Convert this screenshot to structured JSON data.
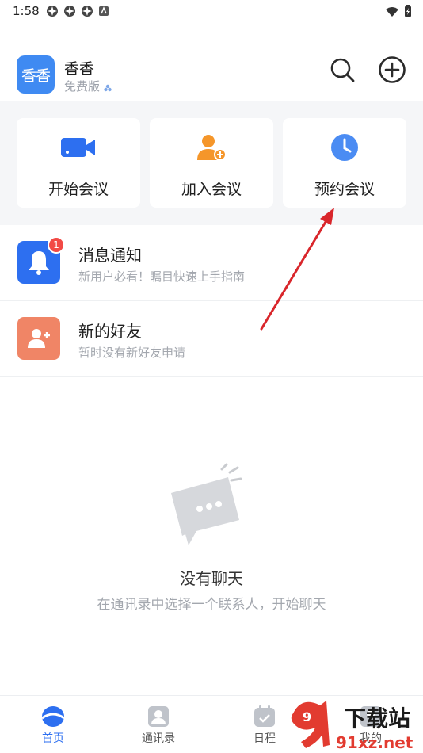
{
  "status_bar": {
    "time": "1:58"
  },
  "header": {
    "avatar_text": "香香",
    "user_name": "香香",
    "plan": "免费版"
  },
  "meeting_actions": [
    {
      "label": "开始会议",
      "icon": "video-camera-icon",
      "color": "#2d6ff0"
    },
    {
      "label": "加入会议",
      "icon": "add-user-icon",
      "color": "#f5962a"
    },
    {
      "label": "预约会议",
      "icon": "clock-icon",
      "color": "#4b8cf3"
    }
  ],
  "list": {
    "notice": {
      "title": "消息通知",
      "subtitle": "新用户必看！瞩目快速上手指南",
      "badge": "1",
      "icon": "bell-icon",
      "color": "#2d6ff0"
    },
    "friends": {
      "title": "新的好友",
      "subtitle": "暂时没有新好友申请",
      "icon": "add-friend-icon",
      "color": "#f08566"
    }
  },
  "empty_state": {
    "title": "没有聊天",
    "subtitle": "在通讯录中选择一个联系人，开始聊天"
  },
  "bottom_nav": [
    {
      "label": "首页",
      "icon": "home-icon",
      "active": true
    },
    {
      "label": "通讯录",
      "icon": "contacts-icon",
      "active": false
    },
    {
      "label": "日程",
      "icon": "calendar-icon",
      "active": false
    },
    {
      "label": "我的",
      "icon": "profile-icon",
      "active": false
    }
  ],
  "watermark": {
    "text_top": "下载站",
    "text_bottom": "91xz.net"
  },
  "colors": {
    "brand_blue": "#2d6ff0",
    "panel_bg": "#f5f6f8",
    "annotation_red": "#d9262b"
  }
}
